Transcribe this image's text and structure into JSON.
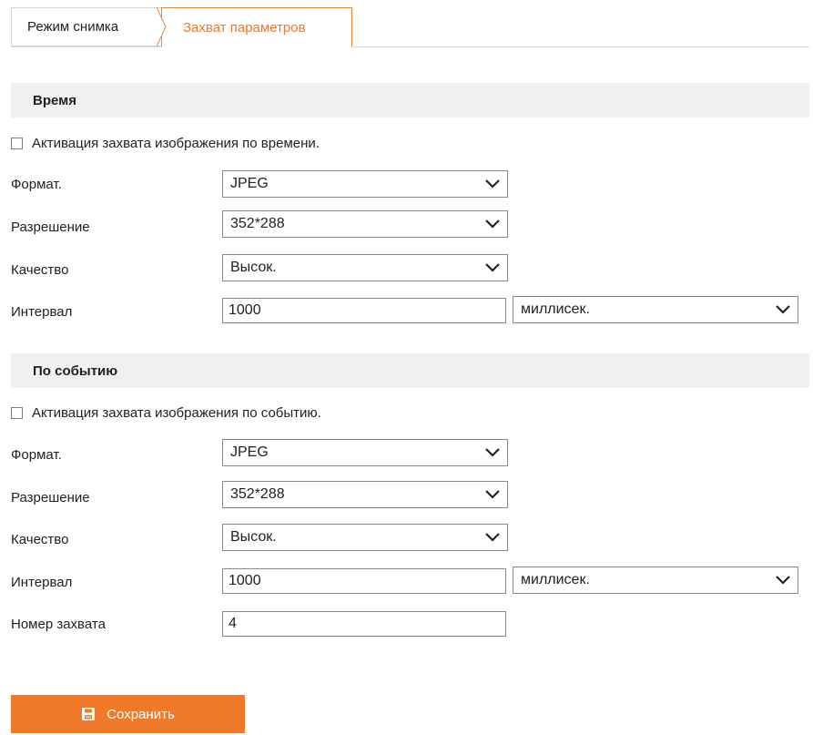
{
  "tabs": [
    {
      "label": "Режим снимка"
    },
    {
      "label": "Захват параметров"
    }
  ],
  "time_section": {
    "title": "Время",
    "checkbox_label": "Активация захвата изображения по времени.",
    "format_label": "Формат.",
    "format_value": "JPEG",
    "resolution_label": "Разрешение",
    "resolution_value": "352*288",
    "quality_label": "Качество",
    "quality_value": "Высок.",
    "interval_label": "Интервал",
    "interval_value": "1000",
    "interval_unit": "миллисек."
  },
  "event_section": {
    "title": "По событию",
    "checkbox_label": "Активация захвата изображения по событию.",
    "format_label": "Формат.",
    "format_value": "JPEG",
    "resolution_label": "Разрешение",
    "resolution_value": "352*288",
    "quality_label": "Качество",
    "quality_value": "Высок.",
    "interval_label": "Интервал",
    "interval_value": "1000",
    "interval_unit": "миллисек.",
    "capture_number_label": "Номер захвата",
    "capture_number_value": "4"
  },
  "save_button": {
    "label": "Сохранить",
    "icon": "save-icon",
    "color": "#f07a2a"
  },
  "colors": {
    "accent": "#e8782d",
    "section_bg": "#f0f0f0"
  }
}
